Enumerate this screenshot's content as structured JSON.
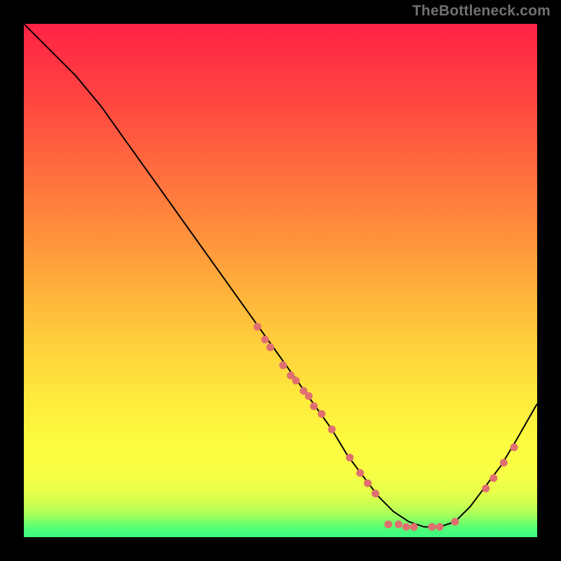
{
  "watermark": "TheBottleneck.com",
  "gradient": {
    "stops": [
      {
        "offset": 0.0,
        "color": "#ff2246"
      },
      {
        "offset": 0.14,
        "color": "#ff4341"
      },
      {
        "offset": 0.28,
        "color": "#ff6b3e"
      },
      {
        "offset": 0.4,
        "color": "#ff8d3c"
      },
      {
        "offset": 0.52,
        "color": "#ffb13b"
      },
      {
        "offset": 0.63,
        "color": "#ffd13b"
      },
      {
        "offset": 0.73,
        "color": "#feea3c"
      },
      {
        "offset": 0.81,
        "color": "#fdfb3f"
      },
      {
        "offset": 0.872,
        "color": "#f9ff44"
      },
      {
        "offset": 0.912,
        "color": "#e7ff4a"
      },
      {
        "offset": 0.938,
        "color": "#c9ff52"
      },
      {
        "offset": 0.957,
        "color": "#a3ff5c"
      },
      {
        "offset": 0.972,
        "color": "#73ff6a"
      },
      {
        "offset": 0.985,
        "color": "#4dff79"
      },
      {
        "offset": 1.0,
        "color": "#3cf883"
      }
    ]
  },
  "chart_data": {
    "type": "line",
    "title": "",
    "xlabel": "",
    "ylabel": "",
    "xlim": [
      0,
      100
    ],
    "ylim": [
      0,
      100
    ],
    "series": [
      {
        "name": "bottleneck-curve",
        "x": [
          0,
          5,
          10,
          15,
          20,
          25,
          30,
          35,
          40,
          45,
          50,
          55,
          60,
          63,
          66,
          69,
          72,
          75,
          78,
          81,
          84,
          87,
          90,
          93,
          96,
          100
        ],
        "y": [
          100,
          95,
          90,
          84,
          77,
          70,
          63,
          56,
          49,
          42,
          35,
          28,
          21,
          16,
          12,
          8,
          5,
          3,
          2,
          2,
          3,
          6,
          10,
          14,
          19,
          26
        ]
      }
    ],
    "markers": {
      "name": "highlight-dots",
      "color": "#e07070",
      "radius": 5.5,
      "points": [
        {
          "x": 45.5,
          "y": 41.0
        },
        {
          "x": 47.0,
          "y": 38.5
        },
        {
          "x": 48.0,
          "y": 37.0
        },
        {
          "x": 50.5,
          "y": 33.5
        },
        {
          "x": 52.0,
          "y": 31.5
        },
        {
          "x": 53.0,
          "y": 30.5
        },
        {
          "x": 54.5,
          "y": 28.5
        },
        {
          "x": 55.5,
          "y": 27.5
        },
        {
          "x": 56.5,
          "y": 25.5
        },
        {
          "x": 58.0,
          "y": 24.0
        },
        {
          "x": 60.0,
          "y": 21.0
        },
        {
          "x": 63.5,
          "y": 15.5
        },
        {
          "x": 65.5,
          "y": 12.5
        },
        {
          "x": 67.0,
          "y": 10.5
        },
        {
          "x": 68.5,
          "y": 8.5
        },
        {
          "x": 71.0,
          "y": 2.5
        },
        {
          "x": 73.0,
          "y": 2.5
        },
        {
          "x": 74.5,
          "y": 2.0
        },
        {
          "x": 76.0,
          "y": 2.0
        },
        {
          "x": 79.5,
          "y": 2.0
        },
        {
          "x": 81.0,
          "y": 2.0
        },
        {
          "x": 84.0,
          "y": 3.0
        },
        {
          "x": 90.0,
          "y": 9.5
        },
        {
          "x": 91.5,
          "y": 11.5
        },
        {
          "x": 93.5,
          "y": 14.5
        },
        {
          "x": 95.5,
          "y": 17.5
        }
      ]
    }
  }
}
